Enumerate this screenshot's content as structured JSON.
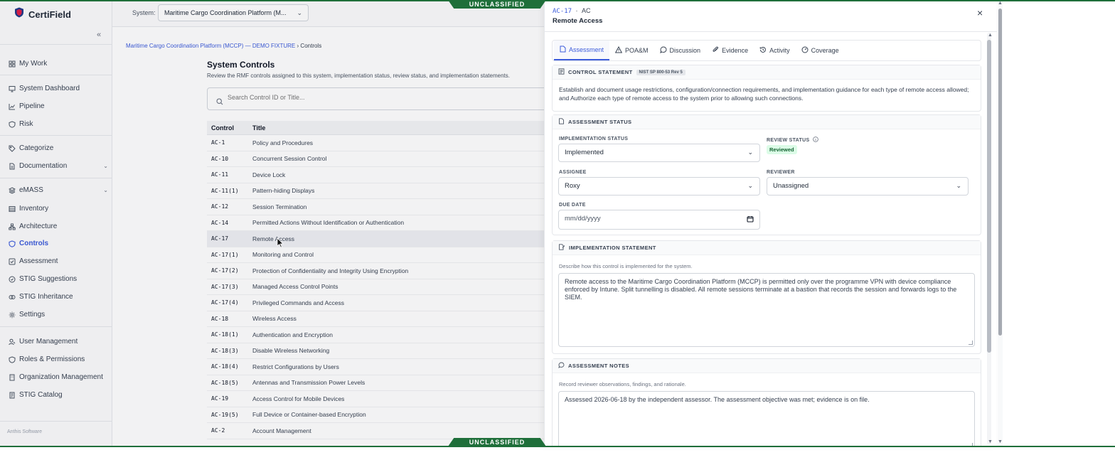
{
  "banner": {
    "top": "UNCLASSIFIED",
    "bottom": "UNCLASSIFIED"
  },
  "brand": {
    "name": "CertiField"
  },
  "header": {
    "system_label": "System:",
    "system_value": "Maritime Cargo Coordination Platform (M..."
  },
  "sidebar": {
    "collapse_glyph": "«",
    "items": [
      {
        "label": "My Work",
        "icon": "grid-icon"
      },
      {
        "label": "System Dashboard",
        "icon": "monitor-icon"
      },
      {
        "label": "Pipeline",
        "icon": "chart-line-icon"
      },
      {
        "label": "Risk",
        "icon": "shield-icon"
      },
      {
        "label": "Categorize",
        "icon": "tag-icon"
      },
      {
        "label": "Documentation",
        "icon": "document-icon"
      },
      {
        "label": "eMASS",
        "icon": "layers-icon"
      },
      {
        "label": "Inventory",
        "icon": "list-icon"
      },
      {
        "label": "Architecture",
        "icon": "network-icon"
      },
      {
        "label": "Controls",
        "icon": "shield-icon"
      },
      {
        "label": "Assessment",
        "icon": "check-square-icon"
      },
      {
        "label": "STIG Suggestions",
        "icon": "sparkle-icon"
      },
      {
        "label": "STIG Inheritance",
        "icon": "link-icon"
      },
      {
        "label": "Settings",
        "icon": "gear-icon"
      },
      {
        "label": "User Management",
        "icon": "user-icon"
      },
      {
        "label": "Roles & Permissions",
        "icon": "shield-icon"
      },
      {
        "label": "Organization Management",
        "icon": "building-icon"
      },
      {
        "label": "STIG Catalog",
        "icon": "book-icon"
      }
    ],
    "footer": "Anthis Software"
  },
  "main": {
    "breadcrumb": {
      "link": "Maritime Cargo Coordination Platform (MCCP) — DEMO FIXTURE",
      "sep": "›",
      "current": "Controls"
    },
    "title": "System Controls",
    "subtitle": "Review the RMF controls assigned to this system, implementation status, review status, and implementation statements.",
    "search_placeholder": "Search Control ID or Title...",
    "table": {
      "headers": [
        "Control",
        "Title"
      ],
      "rows": [
        [
          "AC-1",
          "Policy and Procedures"
        ],
        [
          "AC-10",
          "Concurrent Session Control"
        ],
        [
          "AC-11",
          "Device Lock"
        ],
        [
          "AC-11(1)",
          "Pattern-hiding Displays"
        ],
        [
          "AC-12",
          "Session Termination"
        ],
        [
          "AC-14",
          "Permitted Actions Without Identification or Authentication"
        ],
        [
          "AC-17",
          "Remote Access"
        ],
        [
          "AC-17(1)",
          "Monitoring and Control"
        ],
        [
          "AC-17(2)",
          "Protection of Confidentiality and Integrity Using Encryption"
        ],
        [
          "AC-17(3)",
          "Managed Access Control Points"
        ],
        [
          "AC-17(4)",
          "Privileged Commands and Access"
        ],
        [
          "AC-18",
          "Wireless Access"
        ],
        [
          "AC-18(1)",
          "Authentication and Encryption"
        ],
        [
          "AC-18(3)",
          "Disable Wireless Networking"
        ],
        [
          "AC-18(4)",
          "Restrict Configurations by Users"
        ],
        [
          "AC-18(5)",
          "Antennas and Transmission Power Levels"
        ],
        [
          "AC-19",
          "Access Control for Mobile Devices"
        ],
        [
          "AC-19(5)",
          "Full Device or Container-based Encryption"
        ],
        [
          "AC-2",
          "Account Management"
        ]
      ]
    }
  },
  "drawer": {
    "control_id": "AC-17",
    "separator": "·",
    "family": "AC",
    "title": "Remote Access",
    "close_glyph": "×",
    "tabs": [
      {
        "label": "Assessment",
        "icon": "document-icon"
      },
      {
        "label": "POA&M",
        "icon": "warning-icon"
      },
      {
        "label": "Discussion",
        "icon": "chat-icon"
      },
      {
        "label": "Evidence",
        "icon": "paperclip-icon"
      },
      {
        "label": "Activity",
        "icon": "history-icon"
      },
      {
        "label": "Coverage",
        "icon": "gauge-icon"
      }
    ],
    "control_statement": {
      "heading": "CONTROL STATEMENT",
      "badge": "NIST SP 800-53 Rev 5",
      "text": "Establish and document usage restrictions, configuration/connection requirements, and implementation guidance for each type of remote access allowed; and Authorize each type of remote access to the system prior to allowing such connections."
    },
    "assessment_status": {
      "heading": "ASSESSMENT STATUS",
      "implementation_label": "IMPLEMENTATION STATUS",
      "implementation_value": "Implemented",
      "review_label": "REVIEW STATUS",
      "review_value": "Reviewed",
      "assignee_label": "ASSIGNEE",
      "assignee_value": "Roxy",
      "reviewer_label": "REVIEWER",
      "reviewer_value": "Unassigned",
      "due_label": "DUE DATE",
      "due_placeholder": "mm/dd/yyyy"
    },
    "implementation_statement": {
      "heading": "IMPLEMENTATION STATEMENT",
      "hint": "Describe how this control is implemented for the system.",
      "text": "Remote access to the Maritime Cargo Coordination Platform (MCCP) is permitted only over the programme VPN with device compliance enforced by Intune. Split tunnelling is disabled. All remote sessions terminate at a bastion that records the session and forwards logs to the SIEM."
    },
    "assessment_notes": {
      "heading": "ASSESSMENT NOTES",
      "hint": "Record reviewer observations, findings, and rationale.",
      "text": "Assessed 2026-06-18 by the independent assessor. The assessment objective was met; evidence is on file."
    }
  },
  "colors": {
    "accent": "#3b5bdb",
    "banner": "#1f6f3a",
    "reviewed": "#166534"
  }
}
